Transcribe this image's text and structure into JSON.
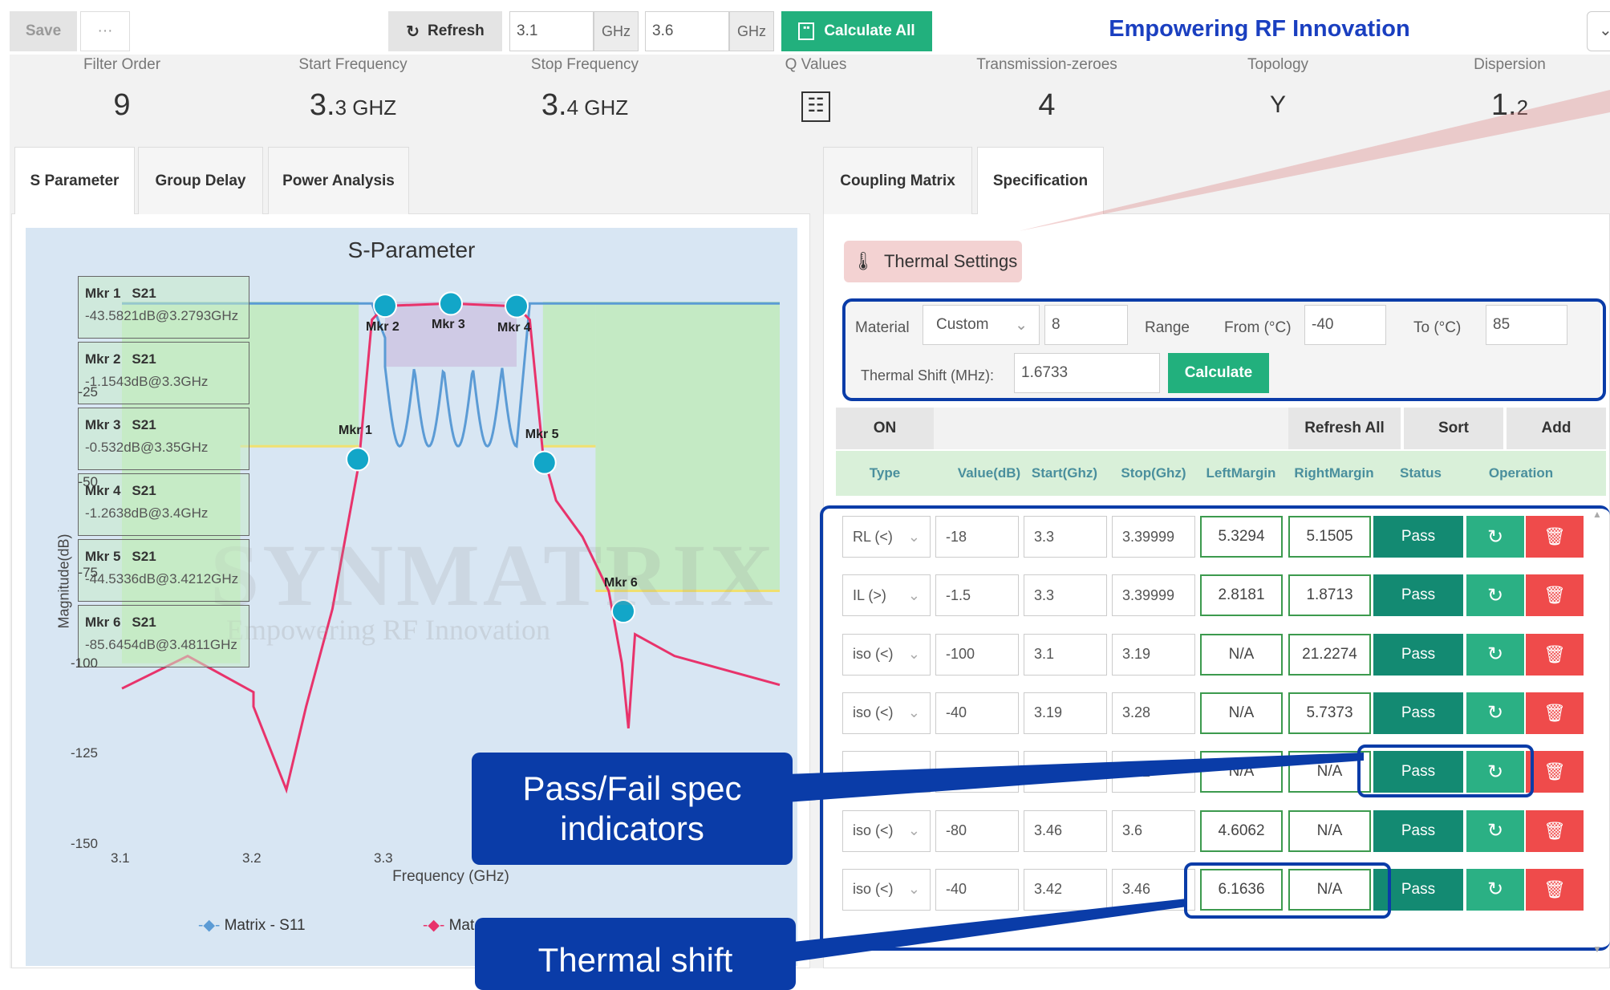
{
  "toolbar": {
    "save": "Save",
    "more": "···",
    "refresh": "Refresh",
    "start_value": "3.1",
    "start_unit": "GHz",
    "stop_value": "3.6",
    "stop_unit": "GHz",
    "calculate_all": "Calculate All",
    "brand": "Empowering RF Innovation"
  },
  "metrics": [
    {
      "label": "Filter Order",
      "value": "9",
      "unit": ""
    },
    {
      "label": "Start Frequency",
      "value": "3.",
      "sub": "3 GHZ"
    },
    {
      "label": "Stop Frequency",
      "value": "3.",
      "sub": "4 GHZ"
    },
    {
      "label": "Q Values",
      "icon": "list-icon"
    },
    {
      "label": "Transmission-zeroes",
      "value": "4"
    },
    {
      "label": "Topology",
      "icon": "topology-icon"
    },
    {
      "label": "Dispersion",
      "value": "1.",
      "sub": "2"
    }
  ],
  "left_tabs": [
    "S Parameter",
    "Group Delay",
    "Power Analysis"
  ],
  "right_tabs": [
    "Coupling Matrix",
    "Specification"
  ],
  "chart_data": {
    "type": "line",
    "title": "S-Parameter",
    "xlabel": "Frequency (GHz)",
    "ylabel": "Magnitude(dB)",
    "xlim": [
      3.1,
      3.6
    ],
    "ylim": [
      -150,
      0
    ],
    "x_ticks": [
      "3.1",
      "3.2",
      "3.3"
    ],
    "y_ticks": [
      "-25",
      "-50",
      "-75",
      "-100",
      "-125",
      "-150"
    ],
    "series": [
      {
        "name": "Matrix - S11"
      },
      {
        "name": "Mat"
      }
    ],
    "markers": [
      {
        "label": "Mkr 1",
        "param": "S21",
        "reading": "-43.5821dB@3.2793GHz",
        "x": 3.2793,
        "y": -43.58
      },
      {
        "label": "Mkr 2",
        "param": "S21",
        "reading": "-1.1543dB@3.3GHz",
        "x": 3.3,
        "y": -1.15
      },
      {
        "label": "Mkr 3",
        "param": "S21",
        "reading": "-0.532dB@3.35GHz",
        "x": 3.35,
        "y": -0.53
      },
      {
        "label": "Mkr 4",
        "param": "S21",
        "reading": "-1.2638dB@3.4GHz",
        "x": 3.4,
        "y": -1.26
      },
      {
        "label": "Mkr 5",
        "param": "S21",
        "reading": "-44.5336dB@3.4212GHz",
        "x": 3.4212,
        "y": -44.53
      },
      {
        "label": "Mkr 6",
        "param": "S21",
        "reading": "-85.6454dB@3.4811GHz",
        "x": 3.4811,
        "y": -85.65
      }
    ],
    "watermark": "SYNMATRIX",
    "watermark_sub": "Empowering RF Innovation"
  },
  "thermal": {
    "title": "Thermal Settings",
    "material_label": "Material",
    "material": "Custom",
    "material_value": "8",
    "range_label": "Range",
    "from_label": "From (°C)",
    "from": "-40",
    "to_label": "To (°C)",
    "to": "85",
    "shift_label": "Thermal Shift (MHz):",
    "shift": "1.6733",
    "calculate": "Calculate"
  },
  "spec_toolbar": {
    "on": "ON",
    "refresh_all": "Refresh All",
    "sort": "Sort",
    "add": "Add"
  },
  "spec_headers": [
    "Type",
    "Value(dB)",
    "Start(Ghz)",
    "Stop(Ghz)",
    "LeftMargin",
    "RightMargin",
    "Status",
    "Operation"
  ],
  "spec_rows": [
    {
      "type": "RL (<)",
      "value": "-18",
      "start": "3.3",
      "stop": "3.39999",
      "left": "5.3294",
      "right": "5.1505",
      "status": "Pass"
    },
    {
      "type": "IL (>)",
      "value": "-1.5",
      "start": "3.3",
      "stop": "3.39999",
      "left": "2.8181",
      "right": "1.8713",
      "status": "Pass"
    },
    {
      "type": "iso (<)",
      "value": "-100",
      "start": "3.1",
      "stop": "3.19",
      "left": "N/A",
      "right": "21.2274",
      "status": "Pass"
    },
    {
      "type": "iso (<)",
      "value": "-40",
      "start": "3.19",
      "stop": "3.28",
      "left": "N/A",
      "right": "5.7373",
      "status": "Pass"
    },
    {
      "type": "",
      "value": "",
      "start": "",
      "stop": "3.42",
      "left": "N/A",
      "right": "N/A",
      "status": "Pass"
    },
    {
      "type": "iso (<)",
      "value": "-80",
      "start": "3.46",
      "stop": "3.6",
      "left": "4.6062",
      "right": "N/A",
      "status": "Pass"
    },
    {
      "type": "iso (<)",
      "value": "-40",
      "start": "3.42",
      "stop": "3.46",
      "left": "6.1636",
      "right": "N/A",
      "status": "Pass"
    }
  ],
  "callouts": {
    "passfail": "Pass/Fail spec indicators",
    "thermal": "Thermal shift"
  },
  "colors": {
    "teal_button": "#22b07d",
    "pass": "#138a72",
    "delete": "#ef4b4b",
    "brand": "#1a3fc0",
    "callout": "#0a3ca8",
    "s11": "#5b9bd5",
    "s21": "#e8336b"
  }
}
